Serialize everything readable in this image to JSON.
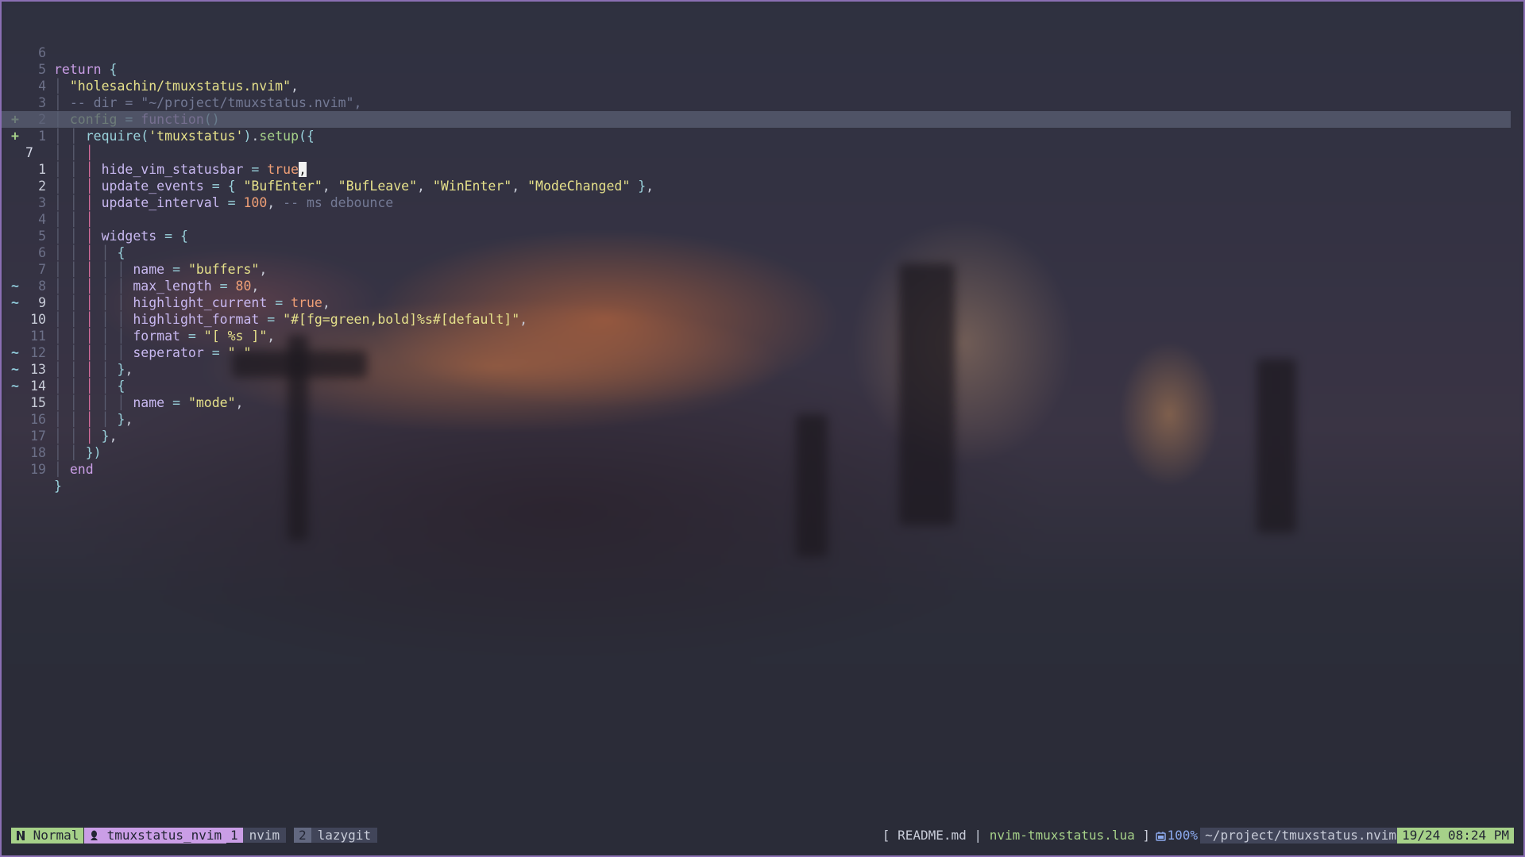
{
  "editor": {
    "lines": [
      {
        "sign": "",
        "num": "6"
      },
      {
        "sign": "",
        "num": "5"
      },
      {
        "sign": "",
        "num": "4"
      },
      {
        "sign": "",
        "num": "3"
      },
      {
        "sign": "",
        "num": "2"
      },
      {
        "sign": "+",
        "num": "1"
      },
      {
        "sign": "+",
        "num": "7"
      },
      {
        "sign": "",
        "num": "1"
      },
      {
        "sign": "",
        "num": "2"
      },
      {
        "sign": "",
        "num": "3"
      },
      {
        "sign": "",
        "num": "4"
      },
      {
        "sign": "",
        "num": "5"
      },
      {
        "sign": "",
        "num": "6"
      },
      {
        "sign": "",
        "num": "7"
      },
      {
        "sign": "",
        "num": "8"
      },
      {
        "sign": "~",
        "num": "9"
      },
      {
        "sign": "~",
        "num": "10"
      },
      {
        "sign": "",
        "num": "11"
      },
      {
        "sign": "",
        "num": "12"
      },
      {
        "sign": "~",
        "num": "13"
      },
      {
        "sign": "~",
        "num": "14"
      },
      {
        "sign": "~",
        "num": "15"
      },
      {
        "sign": "",
        "num": "16"
      },
      {
        "sign": "",
        "num": "17"
      },
      {
        "sign": "",
        "num": "18"
      },
      {
        "sign": "",
        "num": "19"
      }
    ],
    "code": {
      "return_kw": "return",
      "plugin": "\"holesachin/tmuxstatus.nvim\"",
      "dir_comment": "-- dir = \"~/project/tmuxstatus.nvim\",",
      "config_key": "config",
      "function_kw": "function",
      "require_fn": "require",
      "module": "'tmuxstatus'",
      "setup_fn": "setup",
      "hide_key": "hide_vim_statusbar",
      "true_val": "true",
      "update_events_key": "update_events",
      "ev1": "\"BufEnter\"",
      "ev2": "\"BufLeave\"",
      "ev3": "\"WinEnter\"",
      "ev4": "\"ModeChanged\"",
      "update_interval_key": "update_interval",
      "interval_val": "100",
      "debounce_comment": "-- ms debounce",
      "widgets_key": "widgets",
      "name_key": "name",
      "buffers_val": "\"buffers\"",
      "max_length_key": "max_length",
      "max_length_val": "80",
      "highlight_current_key": "highlight_current",
      "highlight_format_key": "highlight_format",
      "highlight_format_val": "\"#[fg=green,bold]%s#[default]\"",
      "format_key": "format",
      "format_val": "\"[ %s ]\"",
      "seperator_key": "seperator",
      "seperator_val": "\" \"",
      "mode_val": "\"mode\"",
      "end_kw": "end"
    }
  },
  "statusline": {
    "mode": "Normal",
    "session": "tmuxstatus_nvim",
    "windows": [
      {
        "index": "1",
        "name": "nvim"
      },
      {
        "index": "2",
        "name": "lazygit"
      }
    ],
    "buffers": {
      "open": "[",
      "inactive": "README.md",
      "sep": "|",
      "active": "nvim-tmuxstatus.lua",
      "close": "]"
    },
    "battery": "100%",
    "cwd": "~/project/tmuxstatus.nvim",
    "clock": "19/24 08:24 PM"
  },
  "colors": {
    "mode_bg": "#a6d189",
    "session_bg": "#ca9ee6",
    "frame": "#8a6fb3"
  }
}
